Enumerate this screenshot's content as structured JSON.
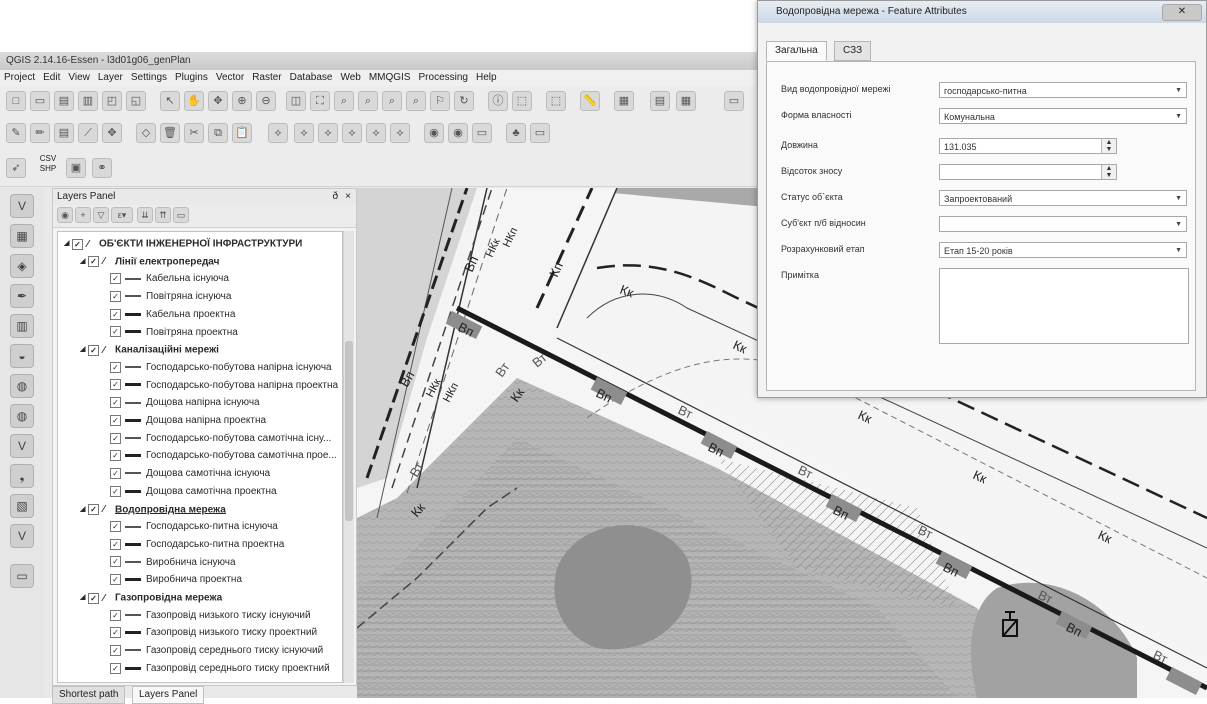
{
  "window": {
    "title": "QGIS 2.14.16-Essen - l3d01g06_genPlan",
    "menu": [
      "Project",
      "Edit",
      "View",
      "Layer",
      "Settings",
      "Plugins",
      "Vector",
      "Raster",
      "Database",
      "Web",
      "MMQGIS",
      "Processing",
      "Help"
    ]
  },
  "toolbar3": {
    "csv_label": "CSV",
    "shp_label": "SHP"
  },
  "layers_panel": {
    "title": "Layers Panel",
    "float_label": "ð",
    "close_label": "×",
    "tabs": [
      "Shortest path",
      "Layers Panel"
    ],
    "tree": [
      {
        "type": "root",
        "label": "ОБ'ЄКТИ ІНЖЕНЕРНОЇ ІНФРАСТРУКТУРИ"
      },
      {
        "type": "group",
        "label": "Лінії електропередач"
      },
      {
        "type": "layer",
        "label": "Кабельна існуюча",
        "style": "existing"
      },
      {
        "type": "layer",
        "label": "Повітряна існуюча",
        "style": "existing"
      },
      {
        "type": "layer",
        "label": "Кабельна проектна",
        "style": "project"
      },
      {
        "type": "layer",
        "label": "Повітряна проектна",
        "style": "project"
      },
      {
        "type": "group",
        "label": "Каналізаційні мережі"
      },
      {
        "type": "layer",
        "label": "Господарсько-побутова напірна існуюча",
        "style": "existing"
      },
      {
        "type": "layer",
        "label": "Господарсько-побутова напірна проектна",
        "style": "project"
      },
      {
        "type": "layer",
        "label": "Дощова напірна існуюча",
        "style": "existing"
      },
      {
        "type": "layer",
        "label": "Дощова напірна проектна",
        "style": "project"
      },
      {
        "type": "layer",
        "label": "Господарсько-побутова самотічна існу...",
        "style": "existing"
      },
      {
        "type": "layer",
        "label": "Господарсько-побутова самотічна прое...",
        "style": "project"
      },
      {
        "type": "layer",
        "label": "Дощова самотічна існуюча",
        "style": "existing"
      },
      {
        "type": "layer",
        "label": "Дощова самотічна проектна",
        "style": "project"
      },
      {
        "type": "group",
        "label": "Водопровідна мережа",
        "selected": true
      },
      {
        "type": "layer",
        "label": "Господарсько-питна існуюча",
        "style": "existing"
      },
      {
        "type": "layer",
        "label": "Господарсько-питна проектна",
        "style": "project"
      },
      {
        "type": "layer",
        "label": "Виробнича існуюча",
        "style": "existing"
      },
      {
        "type": "layer",
        "label": "Виробнича проектна",
        "style": "project"
      },
      {
        "type": "group",
        "label": "Газопровідна мережа"
      },
      {
        "type": "layer",
        "label": "Газопровід низького тиску існуючий",
        "style": "existing"
      },
      {
        "type": "layer",
        "label": "Газопровід низького тиску проектний",
        "style": "project"
      },
      {
        "type": "layer",
        "label": "Газопровід середнього тиску існуючий",
        "style": "existing"
      },
      {
        "type": "layer",
        "label": "Газопровід середнього тиску проектний",
        "style": "project"
      }
    ]
  },
  "map": {
    "labels": {
      "vp": "Вп",
      "vt": "Вт",
      "kk": "Кк",
      "kp": "Кп",
      "nkk": "НКк",
      "nkp": "НКп"
    }
  },
  "dialog": {
    "title": "Водопровідна мережа - Feature Attributes",
    "close_label": "✕",
    "tabs": [
      "Загальна",
      "СЗЗ"
    ],
    "fields": [
      {
        "label": "Вид водопровідної мережі",
        "value": "господарсько-питна",
        "kind": "combo"
      },
      {
        "label": "Форма власності",
        "value": "Комунальна",
        "kind": "combo"
      },
      {
        "label": "Довжина",
        "value": "131.035",
        "kind": "spin"
      },
      {
        "label": "Відсоток зносу",
        "value": "",
        "kind": "spin"
      },
      {
        "label": "Статус об`єкта",
        "value": "Запроектований",
        "kind": "combo"
      },
      {
        "label": "Суб'єкт п/б відносин",
        "value": "",
        "kind": "combo"
      },
      {
        "label": "Розрахунковий етап",
        "value": "Етап 15-20 років",
        "kind": "combo"
      },
      {
        "label": "Примітка",
        "value": "",
        "kind": "text"
      }
    ]
  }
}
